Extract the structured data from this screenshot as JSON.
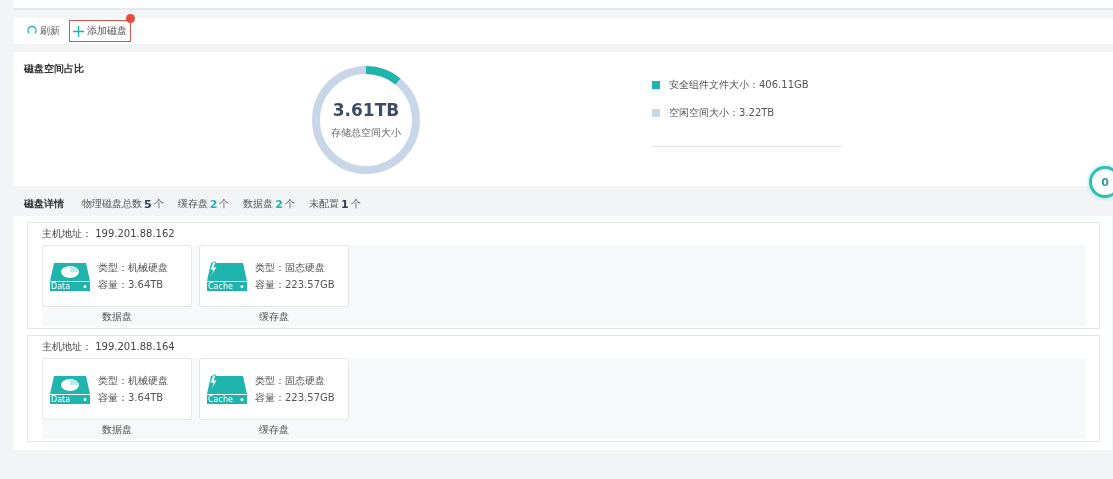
{
  "toolbar": {
    "refresh": "刷新",
    "add_disk": "添加磁盘",
    "add_badge": true
  },
  "space": {
    "title": "磁盘空间占比",
    "total": "3.61TB",
    "total_label": "存储总空间大小",
    "level": 0.11,
    "legend": [
      {
        "label": "安全组件文件大小：406.11GB",
        "color": "#1fb5ac"
      },
      {
        "label": "空闲空间大小：3.22TB",
        "color": "#c8d6e8"
      }
    ]
  },
  "float_count": "0",
  "details": {
    "title": "磁盘详情",
    "stats": [
      {
        "label": "物理磁盘总数",
        "count": "5",
        "unit": "个",
        "color": "#333f57"
      },
      {
        "label": "缓存盘",
        "count": "2",
        "unit": "个",
        "color": "#1fb5ac"
      },
      {
        "label": "数据盘",
        "count": "2",
        "unit": "个",
        "color": "#1fb5ac"
      },
      {
        "label": "未配置",
        "count": "1",
        "unit": "个",
        "color": "#333f57"
      }
    ]
  },
  "hosts": [
    {
      "address": "主机地址： 199.201.88.162",
      "disks": [
        {
          "kind": "data",
          "tag": "Data",
          "type": "类型：机械硬盘",
          "capacity": "容量：3.64TB",
          "caption": "数据盘"
        },
        {
          "kind": "cache",
          "tag": "Cache",
          "type": "类型：固态硬盘",
          "capacity": "容量：223.57GB",
          "caption": "缓存盘"
        }
      ]
    },
    {
      "address": "主机地址： 199.201.88.164",
      "disks": [
        {
          "kind": "data",
          "tag": "Data",
          "type": "类型：机械硬盘",
          "capacity": "容量：3.64TB",
          "caption": "数据盘"
        },
        {
          "kind": "cache",
          "tag": "Cache",
          "type": "类型：固态硬盘",
          "capacity": "容量：223.57GB",
          "caption": "缓存盘"
        }
      ]
    }
  ]
}
